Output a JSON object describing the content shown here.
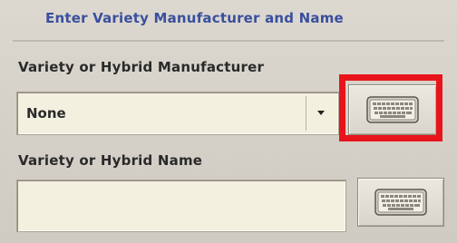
{
  "dialog": {
    "title": "Enter Variety Manufacturer and Name"
  },
  "manufacturer": {
    "label": "Variety or Hybrid Manufacturer",
    "selected_value": "None"
  },
  "name": {
    "label": "Variety or Hybrid Name",
    "value": ""
  },
  "icons": {
    "keyboard": "keyboard-icon",
    "dropdown": "chevron-down-icon"
  },
  "colors": {
    "title": "#3a4f9e",
    "highlight": "#e8141b",
    "field_bg": "#f4f0df"
  }
}
